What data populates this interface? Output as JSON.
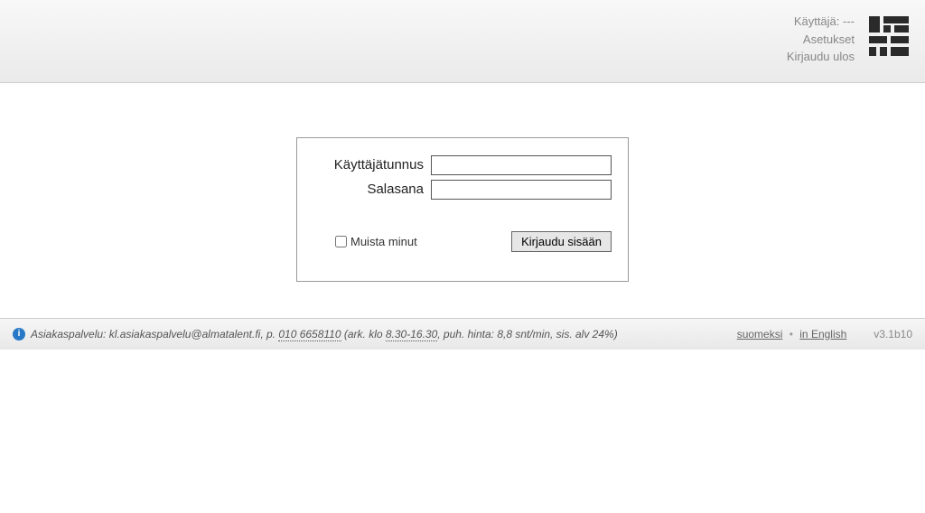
{
  "header": {
    "user_label": "Käyttäjä: ---",
    "settings": "Asetukset",
    "logout": "Kirjaudu ulos"
  },
  "login": {
    "username_label": "Käyttäjätunnus",
    "password_label": "Salasana",
    "username_value": "",
    "password_value": "",
    "remember_label": "Muista minut",
    "submit_label": "Kirjaudu sisään"
  },
  "footer": {
    "service_prefix": "Asiakaspalvelu: ",
    "email": "kl.asiakaspalvelu@almatalent.fi",
    "phone_prefix": ", p. ",
    "phone": "010 6658110",
    "hours_prefix": " (ark. klo ",
    "hours": "8.30-16.30",
    "price_suffix": ", puh. hinta: 8,8 snt/min, sis. alv 24%)",
    "lang_fi": "suomeksi",
    "lang_en": "in English",
    "version": "v3.1b10"
  }
}
